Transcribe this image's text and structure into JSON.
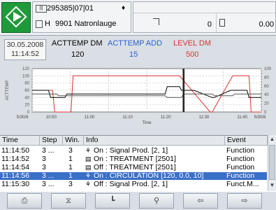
{
  "header": {
    "order_icon": "barcode-icon",
    "order_number": "295385|07|01",
    "header_icon": "tag-icon",
    "recipe_icon": "document-icon",
    "recipe_prefix": "H",
    "recipe_name": "9901 Natronlauge",
    "counter_icon": "counter-icon",
    "counter_value": "0",
    "weight_icon": "scale-icon",
    "weight_value": "0.00"
  },
  "info": {
    "date": "30.05.2008",
    "time": "11:14:52",
    "labels": [
      {
        "text": "ACTTEMP DM",
        "color": "#000000",
        "value": "120",
        "value_color": "#000000"
      },
      {
        "text": "ACTTEMP ADD",
        "color": "#2a5fd0",
        "value": "15",
        "value_color": "#2a5fd0"
      },
      {
        "text": "LEVEL DM",
        "color": "#e03030",
        "value": "500",
        "value_color": "#e03030"
      }
    ]
  },
  "chart_data": {
    "type": "line",
    "x_tick_labels": [
      "5/30/8",
      "10:50",
      "11:00",
      "11:10",
      "11:20",
      "11:30",
      "11:40",
      "5/30/8"
    ],
    "xlabel": "Time",
    "y_axis_left_label": "ACTTEMP",
    "y_axis_left_ticks": [
      "0",
      "20",
      "40",
      "60",
      "80",
      "100",
      "120"
    ],
    "y_axis_right_ticks": [
      "0",
      "20",
      "40",
      "60",
      "80",
      "100"
    ],
    "cursor_time": "11:14:52",
    "series": [
      {
        "color": "#e03030",
        "x": [
          10.4,
          10.5,
          10.51,
          10.59,
          10.6,
          11.05,
          11.06,
          11.11,
          11.12,
          11.27,
          11.28,
          11.38,
          11.39,
          11.46,
          11.47,
          11.52
        ],
        "y": [
          60,
          60,
          0,
          0,
          100,
          100,
          100,
          100,
          100,
          0,
          0,
          100,
          100,
          100,
          0,
          0
        ]
      },
      {
        "color": "#000000",
        "x": [
          10.4,
          10.48,
          10.49,
          10.56,
          10.57,
          11.05,
          11.06,
          11.12,
          11.13,
          11.18,
          11.19,
          11.28,
          11.29,
          11.37,
          11.38,
          11.45,
          11.46,
          11.52
        ],
        "y": [
          60,
          60,
          40,
          40,
          50,
          50,
          70,
          70,
          60,
          60,
          60,
          40,
          40,
          60,
          60,
          60,
          40,
          40
        ]
      },
      {
        "color": "#555555",
        "x": [
          10.4,
          10.52,
          10.53,
          11.05,
          11.06,
          11.13,
          11.14,
          11.28,
          11.29,
          11.38,
          11.39,
          11.52
        ],
        "y": [
          50,
          50,
          45,
          45,
          40,
          40,
          50,
          50,
          45,
          45,
          50,
          50
        ]
      }
    ]
  },
  "table": {
    "columns": [
      "Time",
      "Step",
      "Win.",
      "Info",
      "Event"
    ],
    "rows": [
      {
        "time": "11:14:50",
        "step": "3 ...",
        "win": "3",
        "icon": "valve-icon",
        "info": "On : Signal Prod. [2, 1]",
        "event": "Function",
        "selected": false
      },
      {
        "time": "11:14:52",
        "step": "3",
        "win": "1",
        "icon": "document-icon",
        "info": "On : TREATMENT [2501]",
        "event": "Function",
        "selected": false
      },
      {
        "time": "11:14:54",
        "step": "3",
        "win": "1",
        "icon": "document-icon",
        "info": "Off : TREATMENT [2501]",
        "event": "Function",
        "selected": false
      },
      {
        "time": "11:14:56",
        "step": "3 ...",
        "win": "1",
        "icon": "valve-icon",
        "info": "On : CIRCULATION [120, 0.0, 10]",
        "event": "Function",
        "selected": true
      },
      {
        "time": "11:15:30",
        "step": "3 ...",
        "win": "3",
        "icon": "valve-icon",
        "info": "Off : Signal Prod. [2, 1]",
        "event": "Funct.M...",
        "selected": false
      }
    ]
  },
  "toolbar": {
    "buttons": [
      {
        "name": "print-button",
        "icon": "printer-icon",
        "glyph": "⎙"
      },
      {
        "name": "filter-button",
        "icon": "filter-icon",
        "glyph": "⧖"
      },
      {
        "name": "chart-button",
        "icon": "chart-icon",
        "glyph": "┗"
      },
      {
        "name": "zoom-button",
        "icon": "magnifier-icon",
        "glyph": "⚲"
      },
      {
        "name": "back-button",
        "icon": "arrow-left-icon",
        "glyph": "⇦"
      },
      {
        "name": "forward-button",
        "icon": "arrow-right-icon",
        "glyph": "⇨"
      }
    ]
  },
  "colors": {
    "selection": "#3a6fc8",
    "start_button": "#1f9a3a"
  }
}
